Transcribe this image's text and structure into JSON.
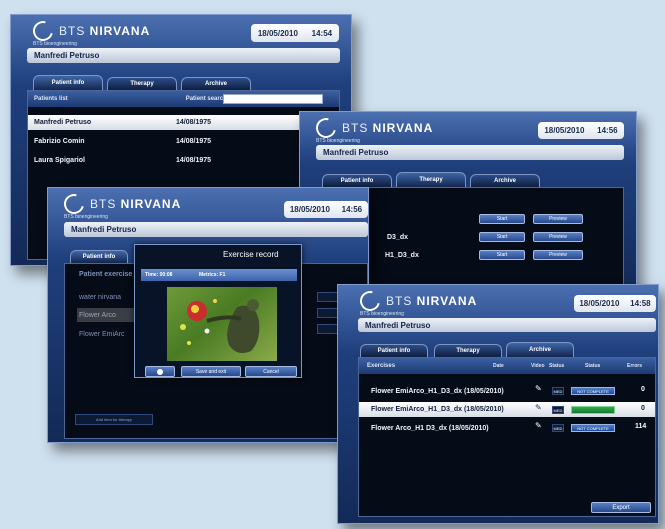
{
  "app": {
    "brand_thin": "BTS ",
    "brand_bold": "NIRVANA",
    "sub": "BTS bioengineering"
  },
  "header": {
    "date": "18/05/2010",
    "time_a": "14:54",
    "time_b": "14:56",
    "time_c": "14:58"
  },
  "patient": {
    "name": "Manfredi Petruso"
  },
  "tabs": {
    "patient_info": "Patient info",
    "therapy": "Therapy",
    "archive": "Archive"
  },
  "win1": {
    "list_title": "Patients list",
    "search_label": "Patient search",
    "search_value": "",
    "patients": [
      {
        "name": "Manfredi Petruso",
        "dob": "14/08/1975"
      },
      {
        "name": "Fabrizio Comin",
        "dob": "14/08/1975"
      },
      {
        "name": "Laura Spigariol",
        "dob": "14/08/1975"
      }
    ]
  },
  "win2": {
    "start_label": "Start",
    "preview_label": "Preview",
    "rows": [
      "D3_dx",
      "H1_D3_dx"
    ]
  },
  "win3": {
    "list_title": "Patient exercise",
    "items": [
      "water nirvana",
      "Flower Arco",
      "Flower EmiArc"
    ],
    "add_label": "Add item for therapy",
    "dialog": {
      "title": "Exercise record",
      "time_label": "Time: 00:08",
      "metrics_label": "Metrics: F1",
      "save_label": "Save and exit",
      "cancel_label": "Cancel"
    }
  },
  "win4": {
    "columns": [
      "Exercises",
      "Date",
      "Video",
      "Status",
      "Status",
      "Errors"
    ],
    "video_label": "MED",
    "status_label": "NOT COMPLETE",
    "rows": [
      {
        "name": "Flower EmiArco_H1_D3_dx (18/05/2010)",
        "count": "0",
        "status": "blue"
      },
      {
        "name": "Flower EmiArco_H1_D3_dx (18/05/2010)",
        "count": "0",
        "status": "green"
      },
      {
        "name": "Flower Arco_H1 D3_dx (18/05/2010)",
        "count": "114",
        "status": "blue"
      }
    ],
    "export_label": "Export"
  },
  "colors": {
    "accent": "#2a4f94",
    "complete": "#2fae54",
    "incomplete": "#2b66b5"
  }
}
